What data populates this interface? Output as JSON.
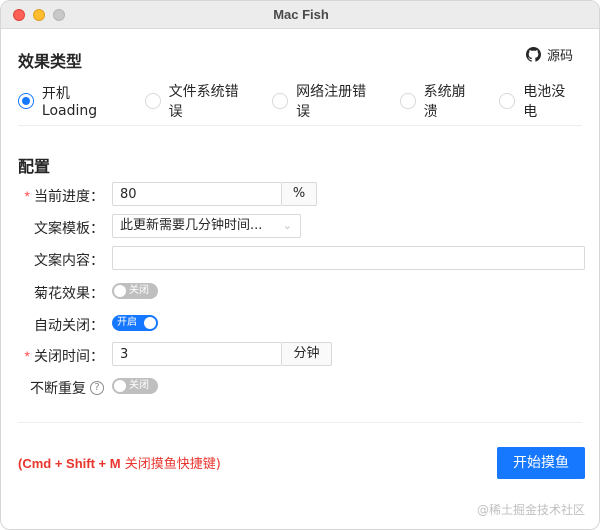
{
  "window": {
    "title": "Mac Fish"
  },
  "effect": {
    "title": "效果类型",
    "source_label": "源码",
    "source_icon": "github-icon",
    "options": [
      {
        "label": "开机Loading",
        "checked": true
      },
      {
        "label": "文件系统错误",
        "checked": false
      },
      {
        "label": "网络注册错误",
        "checked": false
      },
      {
        "label": "系统崩溃",
        "checked": false
      },
      {
        "label": "电池没电",
        "checked": false
      }
    ]
  },
  "config": {
    "title": "配置",
    "progress": {
      "label": "当前进度：",
      "required": true,
      "value": "80",
      "addon": "%"
    },
    "template": {
      "label": "文案模板：",
      "value": "此更新需要几分钟时间..."
    },
    "content": {
      "label": "文案内容：",
      "value": ""
    },
    "chrysanthemum": {
      "label": "菊花效果：",
      "state": "关闭",
      "on": false
    },
    "auto_close": {
      "label": "自动关闭：",
      "state": "开启",
      "on": true
    },
    "close_time": {
      "label": "关闭时间：",
      "required": true,
      "value": "3",
      "addon": "分钟"
    },
    "repeat": {
      "label": "不断重复",
      "help": "?",
      "state": "关闭",
      "on": false
    }
  },
  "footer": {
    "shortcut_keys": "(Cmd + Shift + M",
    "shortcut_text": " 关闭摸鱼快捷键)",
    "start_button": "开始摸鱼",
    "watermark": "@稀土掘金技术社区"
  },
  "colors": {
    "primary": "#1677ff",
    "danger": "#e8352e",
    "required": "#ff4d4f"
  }
}
